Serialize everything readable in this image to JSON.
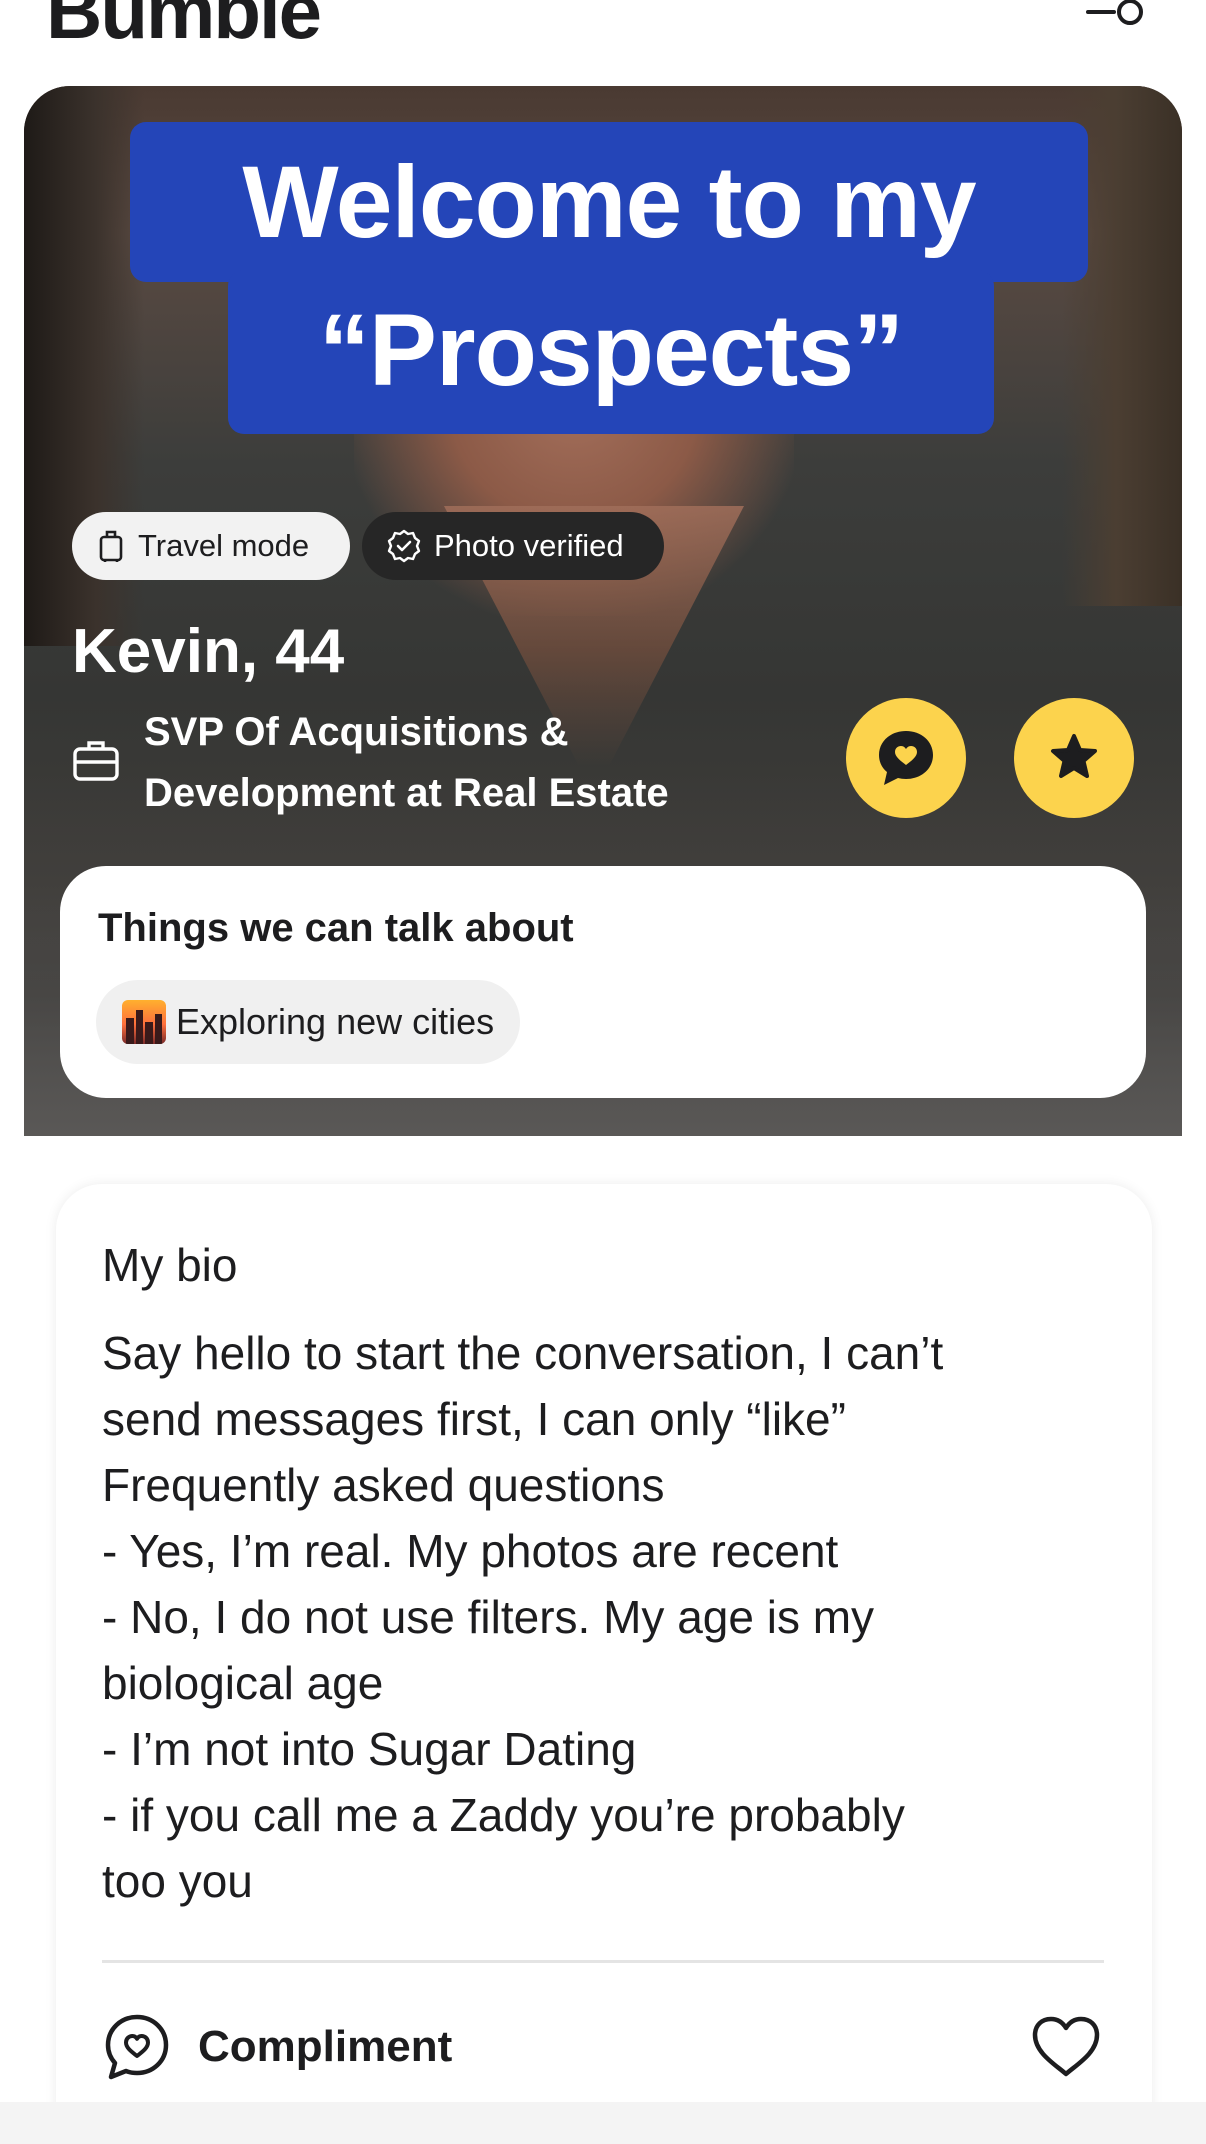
{
  "header": {
    "logo": "Bumble",
    "filter_icon": "filter-icon"
  },
  "profile": {
    "banner_line1": "Welcome to my",
    "banner_line2": "“Prospects”",
    "badges": {
      "travel": "Travel mode",
      "verified": "Photo verified"
    },
    "name_age": "Kevin, 44",
    "job_line1": "SVP Of Acquisitions &",
    "job_line2": "Development at Real Estate",
    "actions": {
      "chat_icon": "heart-chat-icon",
      "star_icon": "star-icon"
    },
    "accent_color": "#fcd34d",
    "banner_color": "#2445b8"
  },
  "talk": {
    "title": "Things we can talk about",
    "topics": [
      "Exploring new cities"
    ]
  },
  "bio": {
    "title": "My bio",
    "lines": [
      "Say hello to start the conversation, I can’t",
      "send messages first, I can only “like”",
      "Frequently asked questions",
      "- Yes, I’m real. My photos are recent",
      "- No, I do not use filters. My age is my",
      "biological age",
      "- I’m not into Sugar Dating",
      "- if you call me a Zaddy you’re probably",
      "too you"
    ],
    "compliment_label": "Compliment",
    "like_icon": "heart-outline-icon"
  }
}
